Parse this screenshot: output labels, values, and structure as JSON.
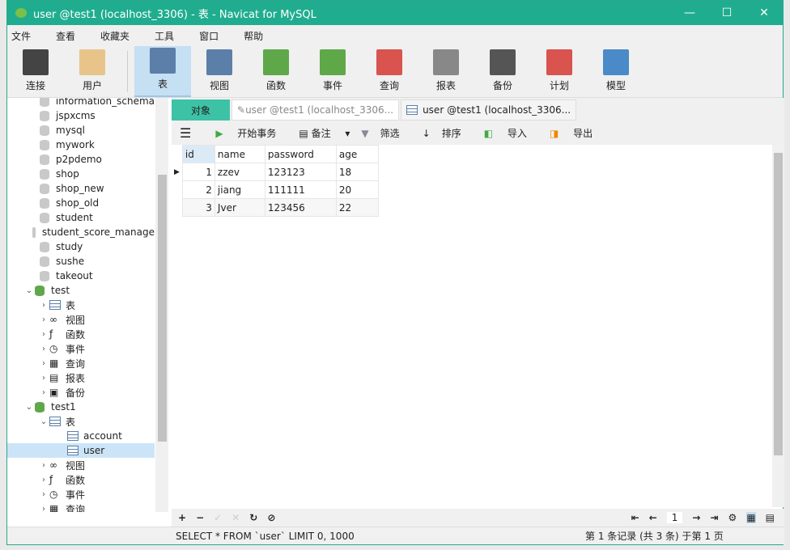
{
  "window": {
    "title": "user @test1 (localhost_3306) - 表 - Navicat for MySQL",
    "controls": [
      "—",
      "☐",
      "✕"
    ]
  },
  "menu": [
    "文件",
    "查看",
    "收藏夹",
    "工具",
    "窗口",
    "帮助"
  ],
  "toolbar": [
    {
      "label": "连接",
      "icon": "plug-server-icon",
      "color": "#444"
    },
    {
      "label": "用户",
      "icon": "user-icon",
      "color": "#e8c48a"
    },
    {
      "label": "表",
      "icon": "table-icon",
      "color": "#5b7fa8",
      "active": true
    },
    {
      "label": "视图",
      "icon": "view-glasses-icon",
      "color": "#5b7fa8"
    },
    {
      "label": "函数",
      "icon": "function-icon",
      "color": "#5fa84a"
    },
    {
      "label": "事件",
      "icon": "event-clock-icon",
      "color": "#5fa84a"
    },
    {
      "label": "查询",
      "icon": "query-icon",
      "color": "#d9534f"
    },
    {
      "label": "报表",
      "icon": "report-icon",
      "color": "#888"
    },
    {
      "label": "备份",
      "icon": "backup-icon",
      "color": "#555"
    },
    {
      "label": "计划",
      "icon": "schedule-icon",
      "color": "#d9534f"
    },
    {
      "label": "模型",
      "icon": "model-icon",
      "color": "#4a8ac8"
    }
  ],
  "sidebar": {
    "databases": [
      "information_schema",
      "jspxcms",
      "mysql",
      "mywork",
      "p2pdemo",
      "shop",
      "shop_new",
      "shop_old",
      "student",
      "student_score_manage",
      "study",
      "sushe",
      "takeout"
    ],
    "test": {
      "name": "test",
      "children": [
        "表",
        "视图",
        "函数",
        "事件",
        "查询",
        "报表",
        "备份"
      ]
    },
    "test1": {
      "name": "test1",
      "tables_label": "表",
      "tables": [
        "account",
        "user"
      ],
      "children": [
        "视图",
        "函数",
        "事件",
        "查询"
      ]
    }
  },
  "tabs": {
    "objects": "对象",
    "design": "user @test1 (localhost_3306...",
    "data": "user @test1 (localhost_3306..."
  },
  "grid_toolbar": {
    "begin_tx": "开始事务",
    "note": "备注",
    "filter": "筛选",
    "sort": "排序",
    "import": "导入",
    "export": "导出"
  },
  "table": {
    "columns": [
      "id",
      "name",
      "password",
      "age"
    ],
    "rows": [
      [
        "1",
        "zzev",
        "123123",
        "18"
      ],
      [
        "2",
        "jiang",
        "111111",
        "20"
      ],
      [
        "3",
        "Jver",
        "123456",
        "22"
      ]
    ]
  },
  "nav": {
    "page": "1"
  },
  "status": {
    "sql": "SELECT * FROM `user` LIMIT 0, 1000",
    "record": "第 1 条记录 (共 3 条) 于第 1 页"
  }
}
